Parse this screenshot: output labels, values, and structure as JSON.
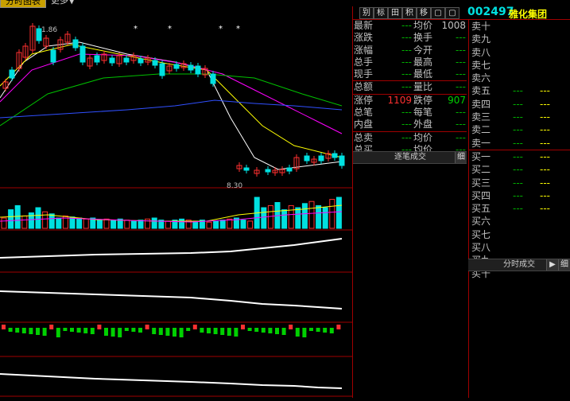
{
  "top_tabs": {
    "active": "分时图表",
    "more": "更多▼"
  },
  "chart": {
    "high_label": "1.86",
    "low_label": "8.30",
    "markers": [
      "*",
      "*",
      "*",
      "*"
    ]
  },
  "toolbar": [
    "别",
    "标",
    "田",
    "积",
    "移",
    "▢",
    "▢"
  ],
  "stock": {
    "code": "002497",
    "name": "雅化集团"
  },
  "quote": [
    {
      "l1": "最新",
      "v1": "---",
      "l2": "均价",
      "v2": "1008"
    },
    {
      "l1": "涨跌",
      "v1": "---",
      "l2": "换手",
      "v2": "---"
    },
    {
      "l1": "涨幅",
      "v1": "---",
      "l2": "今开",
      "v2": "---"
    },
    {
      "l1": "总手",
      "v1": "---",
      "l2": "最高",
      "v2": "---"
    },
    {
      "l1": "现手",
      "v1": "---",
      "l2": "最低",
      "v2": "---"
    },
    {
      "l1": "总额",
      "v1": "---",
      "l2": "量比",
      "v2": "---"
    },
    {
      "l1": "涨停",
      "v1": "1109",
      "l2": "跌停",
      "v2": "907"
    },
    {
      "l1": "总笔",
      "v1": "---",
      "l2": "每笔",
      "v2": "---"
    },
    {
      "l1": "内盘",
      "v1": "---",
      "l2": "外盘",
      "v2": "---"
    },
    {
      "l1": "总卖",
      "v1": "---",
      "l2": "均价",
      "v2": "---"
    },
    {
      "l1": "总买",
      "v1": "---",
      "l2": "均价",
      "v2": "---"
    }
  ],
  "tick_panel": {
    "title": "逐笔成交",
    "btn": "细"
  },
  "orderbook": {
    "sell": [
      {
        "label": "卖十",
        "p": "",
        "v": ""
      },
      {
        "label": "卖九",
        "p": "",
        "v": ""
      },
      {
        "label": "卖八",
        "p": "",
        "v": ""
      },
      {
        "label": "卖七",
        "p": "",
        "v": ""
      },
      {
        "label": "卖六",
        "p": "",
        "v": ""
      },
      {
        "label": "卖五",
        "p": "---",
        "v": "---"
      },
      {
        "label": "卖四",
        "p": "---",
        "v": "---"
      },
      {
        "label": "卖三",
        "p": "---",
        "v": "---"
      },
      {
        "label": "卖二",
        "p": "---",
        "v": "---"
      },
      {
        "label": "卖一",
        "p": "---",
        "v": "---"
      }
    ],
    "buy": [
      {
        "label": "买一",
        "p": "---",
        "v": "---"
      },
      {
        "label": "买二",
        "p": "---",
        "v": "---"
      },
      {
        "label": "买三",
        "p": "---",
        "v": "---"
      },
      {
        "label": "买四",
        "p": "---",
        "v": "---"
      },
      {
        "label": "买五",
        "p": "---",
        "v": "---"
      },
      {
        "label": "买六",
        "p": "",
        "v": ""
      },
      {
        "label": "买七",
        "p": "",
        "v": ""
      },
      {
        "label": "买八",
        "p": "",
        "v": ""
      },
      {
        "label": "买九",
        "p": "",
        "v": ""
      },
      {
        "label": "买十",
        "p": "",
        "v": ""
      }
    ]
  },
  "timeshare_panel": {
    "title": "分时成交",
    "btn1": "▶",
    "btn2": "细"
  },
  "colors": {
    "up": "#ff3030",
    "down": "#00e0e0",
    "grid": "#a00000",
    "accent": "#ffff00"
  }
}
